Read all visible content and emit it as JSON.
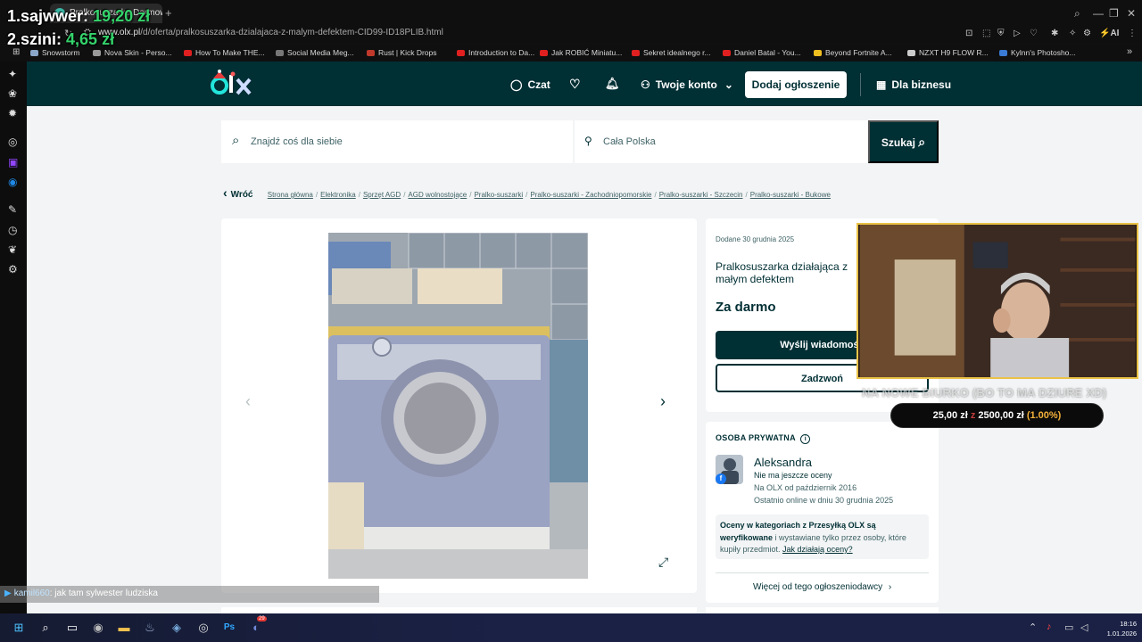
{
  "browser": {
    "tab_title": "Pralkosuszarka Darmowa",
    "new_tab": "+",
    "url_host": "www.olx.pl",
    "url_path": "/d/oferta/pralkosuszarka-dzialajaca-z-malym-defektem-CID99-ID18PLIB.html",
    "bookmarks": [
      {
        "label": "Snowstorm",
        "color": "#8aa6c8"
      },
      {
        "label": "Nova Skin - Perso...",
        "color": "#9a9a9a"
      },
      {
        "label": "How To Make THE...",
        "color": "#e02020"
      },
      {
        "label": "Social Media Meg...",
        "color": "#777777"
      },
      {
        "label": "Rust | Kick Drops",
        "color": "#c0392b"
      },
      {
        "label": "Introduction to Da...",
        "color": "#e02020"
      },
      {
        "label": "Jak ROBIĆ Miniatu...",
        "color": "#e02020"
      },
      {
        "label": "Sekret idealnego r...",
        "color": "#e02020"
      },
      {
        "label": "Daniel Batal - You...",
        "color": "#e02020"
      },
      {
        "label": "Beyond Fortnite A...",
        "color": "#f0c020"
      },
      {
        "label": "NZXT H9 FLOW R...",
        "color": "#cccccc"
      },
      {
        "label": "Kylnn's Photosho...",
        "color": "#3a7bd5"
      }
    ]
  },
  "overlay": {
    "rank1": {
      "label": "1.sajwwer:",
      "amount": "19,20 zł"
    },
    "rank2": {
      "label": "2.szini:",
      "amount": "4,65 zł"
    },
    "goal_title": "NA NOWE BIURKO (BO TO MA DZIURE XD)",
    "goal_current": "25,00 zł",
    "goal_sep": "z",
    "goal_target": "2500,00 zł",
    "goal_pct": "(1.00%)",
    "chat_user": "kamil660",
    "chat_msg": ": jak tam sylwester ludziska"
  },
  "olx": {
    "header": {
      "chat": "Czat",
      "account": "Twoje konto",
      "add_ad": "Dodaj ogłoszenie",
      "business": "Dla biznesu"
    },
    "search": {
      "placeholder": "Znajdź coś dla siebie",
      "location": "Cała Polska",
      "button": "Szukaj"
    },
    "breadcrumb": {
      "back": "Wróć",
      "items": [
        "Strona główna",
        "Elektronika",
        "Sprzęt AGD",
        "AGD wolnostojące",
        "Pralko-suszarki",
        "Pralko-suszarki - Zachodniopomorskie",
        "Pralko-suszarki - Szczecin",
        "Pralko-suszarki - Bukowe"
      ]
    },
    "listing": {
      "added": "Dodane 30 grudnia 2025",
      "title": "Pralkosuszarka działająca z małym defektem",
      "price": "Za darmo",
      "message_btn": "Wyślij wiadomość",
      "call_btn": "Zadzwoń"
    },
    "seller": {
      "type": "OSOBA PRYWATNA",
      "name": "Aleksandra",
      "rating": "Nie ma jeszcze oceny",
      "since": "Na OLX od październik 2016",
      "online": "Ostatnio online w dniu 30 grudnia 2025",
      "verify_bold1": "Oceny w kategoriach z Przesyłką OLX są",
      "verify_bold2": "weryfikowane",
      "verify_rest": " i wystawiane tylko przez osoby, które kupiły przedmiot. ",
      "verify_link": "Jak działają oceny?",
      "more_ads": "Więcej od tego ogłoszeniodawcy"
    }
  },
  "taskbar": {
    "time": "18:16",
    "date": "1.01.2026",
    "discord_badge": "29"
  },
  "colors": {
    "olx_dark": "#002f34",
    "money_green": "#34d36b",
    "goal_orange": "#f3b13a",
    "cam_border": "#e9c246"
  }
}
